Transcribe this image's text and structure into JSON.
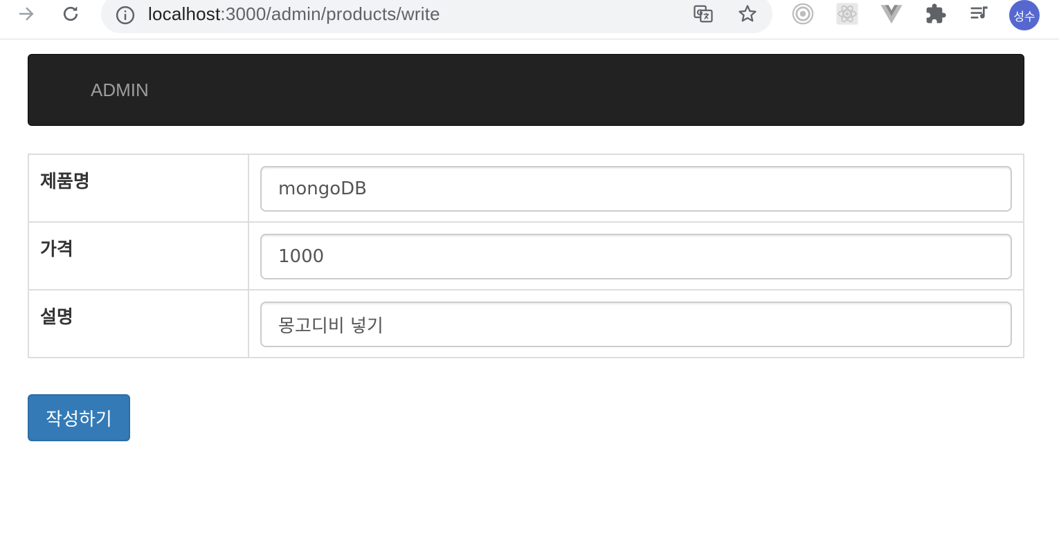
{
  "browser": {
    "url_host": "localhost",
    "url_rest": ":3000/admin/products/write",
    "profile_initials": "성수",
    "icons": [
      "forward-arrow-icon",
      "reload-icon",
      "info-icon",
      "translate-icon",
      "bookmark-star-icon",
      "extension-target-icon",
      "react-devtools-icon",
      "vue-devtools-icon",
      "extensions-puzzle-icon",
      "media-queue-icon"
    ]
  },
  "navbar": {
    "brand": "ADMIN",
    "background": "#222222",
    "brand_color": "#9d9d9d"
  },
  "form": {
    "rows": [
      {
        "label": "제품명",
        "value": "mongoDB"
      },
      {
        "label": "가격",
        "value": "1000"
      },
      {
        "label": "설명",
        "value": "몽고디비 넣기"
      }
    ],
    "submit_label": "작성하기",
    "submit_color": "#337ab7"
  }
}
